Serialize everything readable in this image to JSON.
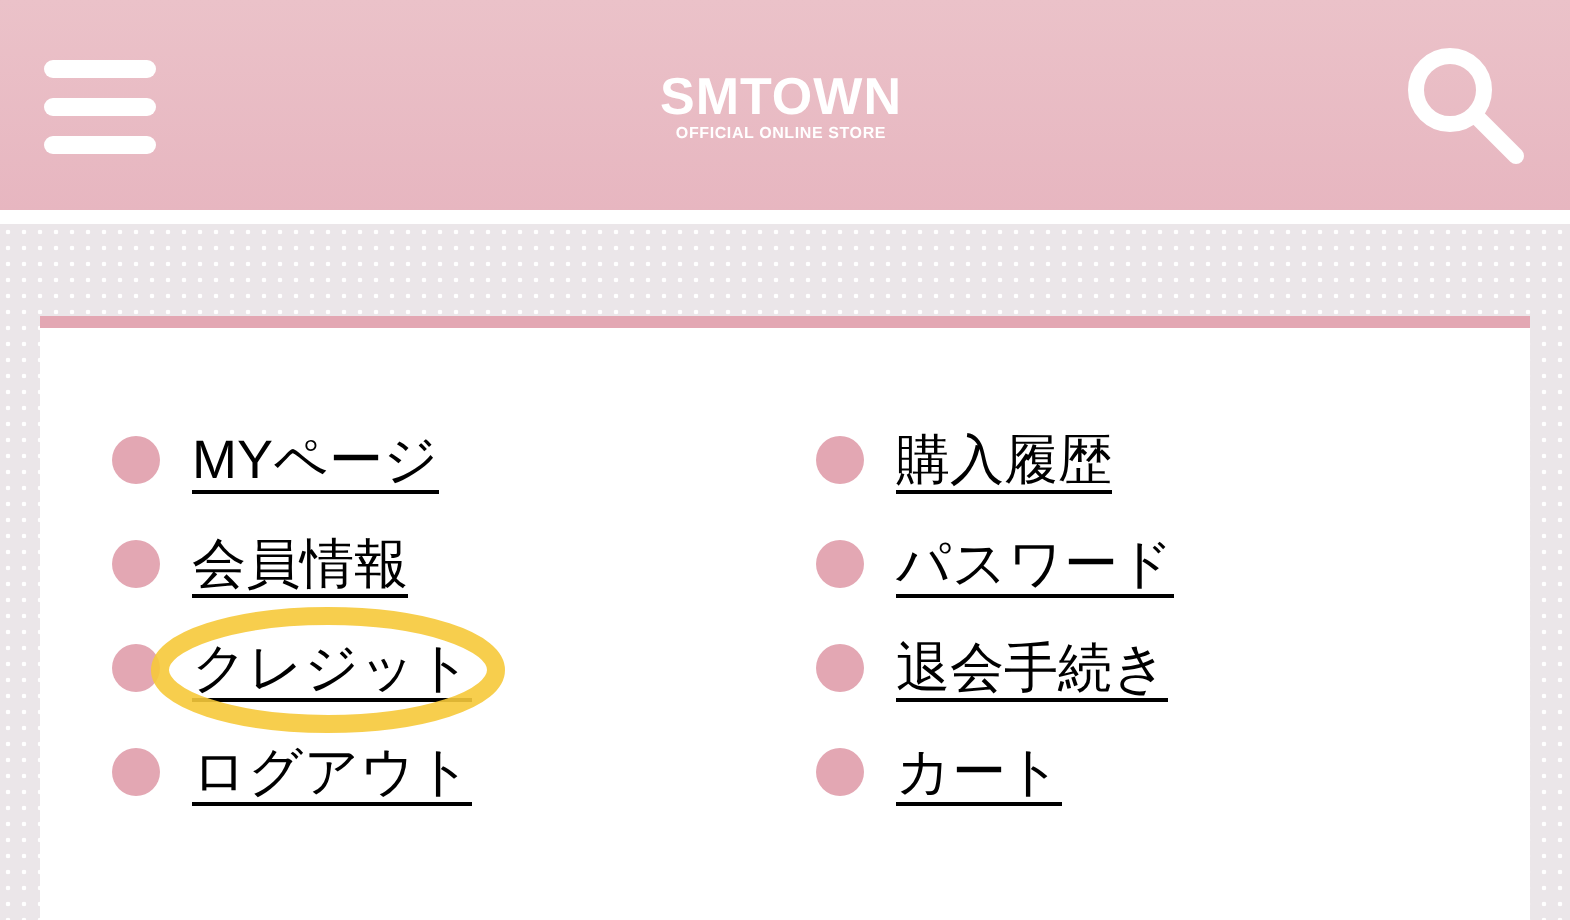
{
  "header": {
    "logo": "SMTOWN",
    "logo_subtitle": "OFFICIAL ONLINE STORE"
  },
  "menu_columns": [
    [
      {
        "label": "MYページ",
        "highlighted": false
      },
      {
        "label": "会員情報",
        "highlighted": false
      },
      {
        "label": "クレジット",
        "highlighted": true
      },
      {
        "label": "ログアウト",
        "highlighted": false
      }
    ],
    [
      {
        "label": "購入履歴",
        "highlighted": false
      },
      {
        "label": "パスワード",
        "highlighted": false
      },
      {
        "label": "退会手続き",
        "highlighted": false
      },
      {
        "label": "カート",
        "highlighted": false
      }
    ]
  ]
}
